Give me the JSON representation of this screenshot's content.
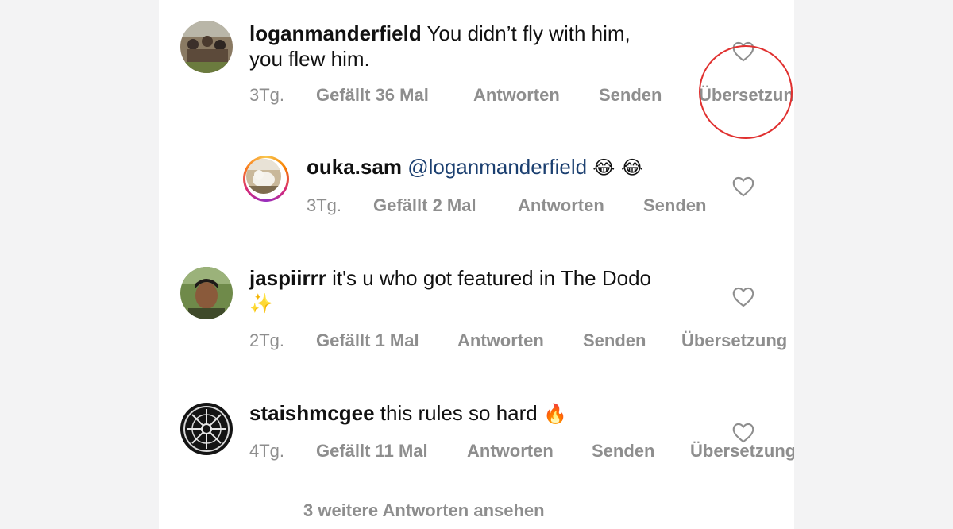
{
  "comments": [
    {
      "username": "loganmanderfield",
      "text_line1": "You didn’t fly with him,",
      "text_line2": "you flew him.",
      "time": "3Tg.",
      "likes": "Gefällt 36 Mal",
      "reply": "Antworten",
      "send": "Senden",
      "translate": "Übersetzung"
    },
    {
      "username": "ouka.sam",
      "mention": "@loganmanderfield",
      "emojis": "😂 😂",
      "time": "3Tg.",
      "likes": "Gefällt 2 Mal",
      "reply": "Antworten",
      "send": "Senden"
    },
    {
      "username": "jaspiirrr",
      "text_line1": "it's u who got featured in The Dodo",
      "emoji_line2": "✨",
      "time": "2Tg.",
      "likes": "Gefällt 1 Mal",
      "reply": "Antworten",
      "send": "Senden",
      "translate": "Übersetzung"
    },
    {
      "username": "staishmcgee",
      "text_line1": "this rules so hard",
      "emoji": "🔥",
      "time": "4Tg.",
      "likes": "Gefällt 11 Mal",
      "reply": "Antworten",
      "send": "Senden",
      "translate": "Übersetzung"
    }
  ],
  "more_replies": "3 weitere Antworten ansehen",
  "colors": {
    "annotation": "#e0302f",
    "mention": "#1b3f70",
    "meta_text": "#8e8e8e"
  }
}
